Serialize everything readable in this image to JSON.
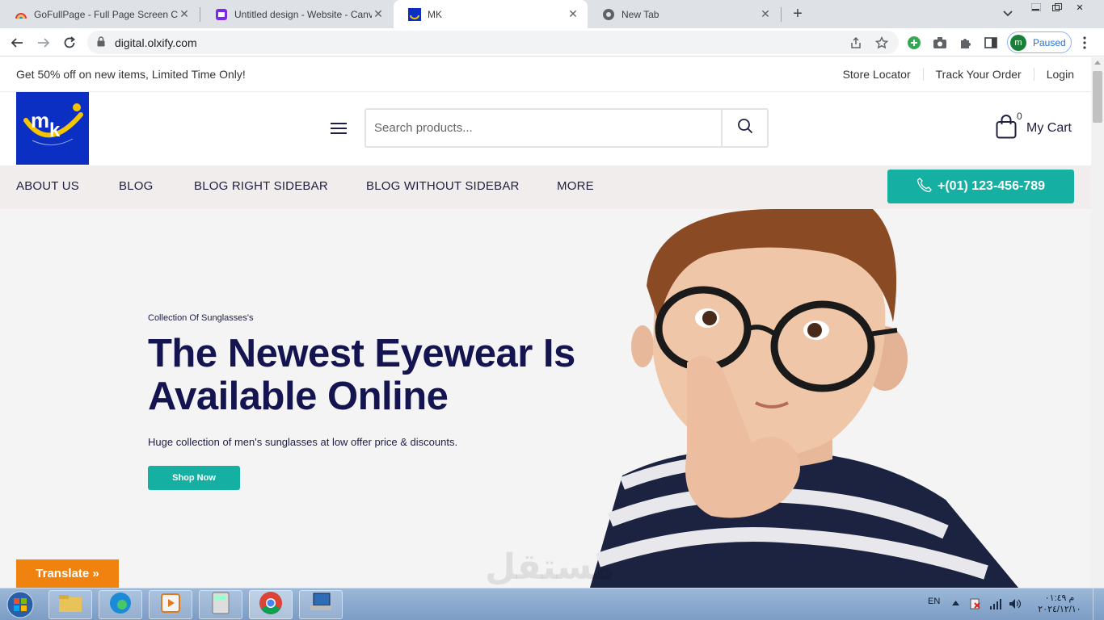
{
  "browser": {
    "tabs": [
      {
        "title": "GoFullPage - Full Page Screen Ca",
        "active": false
      },
      {
        "title": "Untitled design - Website - Canv",
        "active": false
      },
      {
        "title": "MK",
        "active": true
      },
      {
        "title": "New Tab",
        "active": false
      }
    ],
    "url": "digital.olxify.com",
    "profile_initial": "m",
    "profile_status": "Paused"
  },
  "topbar": {
    "promo": "Get 50% off on new items, Limited Time Only!",
    "links": [
      "Store Locator",
      "Track Your Order",
      "Login"
    ]
  },
  "header": {
    "search_placeholder": "Search products...",
    "cart_count": "0",
    "cart_label": "My Cart"
  },
  "nav": {
    "items": [
      "ABOUT US",
      "BLOG",
      "BLOG RIGHT SIDEBAR",
      "BLOG WITHOUT SIDEBAR",
      "MORE"
    ],
    "phone": "+(01) 123-456-789"
  },
  "hero": {
    "eyebrow": "Collection Of Sunglasses's",
    "headline": "The Newest Eyewear Is Available Online",
    "subhead": "Huge collection of men's sunglasses at low offer price & discounts.",
    "cta": "Shop Now"
  },
  "widgets": {
    "translate": "Translate »"
  },
  "taskbar": {
    "lang": "EN",
    "time": "م ٠١:٤٩",
    "date": "٢٠٢٤/١٢/١٠"
  },
  "colors": {
    "accent": "#16b0a3",
    "heading": "#141450",
    "nav_bg": "#f0edec",
    "logo_bg": "#0c2fc3",
    "translate_bg": "#f0820f"
  }
}
